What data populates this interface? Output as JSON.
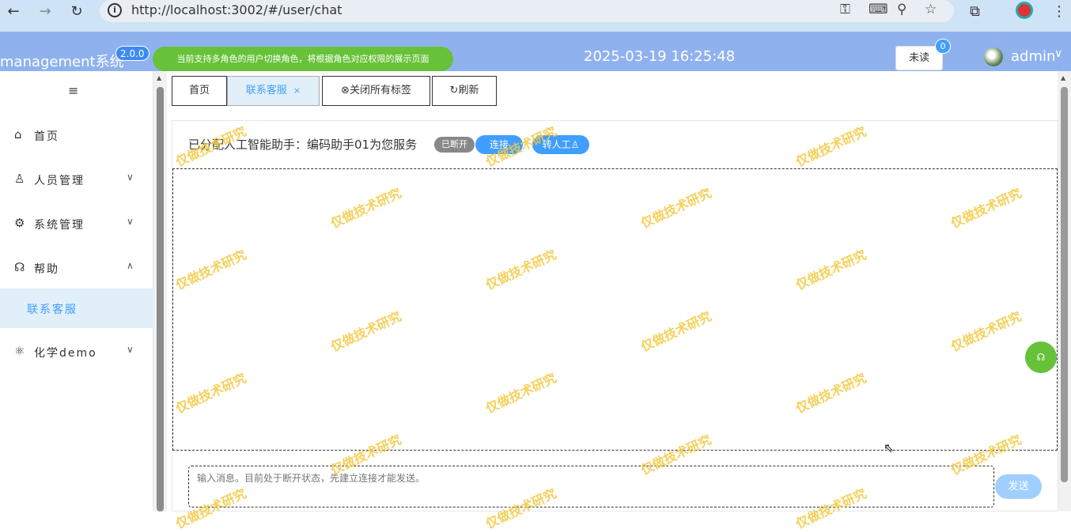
{
  "browser": {
    "url": "http://localhost:3002/#/user/chat",
    "back_icon": "←",
    "forward_icon": "→",
    "reload_icon": "↻",
    "info_icon": "i",
    "key_icon": "⚿",
    "translate_icon": "⌨",
    "zoom_icon": "⚲",
    "star_icon": "☆",
    "ext_icon": "⧉",
    "menu_icon": "⋮"
  },
  "header": {
    "app_title": "management系统",
    "version": "2.0.0",
    "notice": "当前支持多角色的用户切换角色，将根据角色对应权限的展示页面",
    "clock": "2025-03-19 16:25:48",
    "unread_label": "未读",
    "unread_count": "0",
    "username": "admin",
    "chevron": "∨"
  },
  "sidebar": {
    "toggle_icon": "≡",
    "items": [
      {
        "label": "首页",
        "icon": "⌂",
        "chevron": ""
      },
      {
        "label": "人员管理",
        "icon": "♙",
        "chevron": "∨"
      },
      {
        "label": "系统管理",
        "icon": "⚙",
        "chevron": "∨"
      },
      {
        "label": "帮助",
        "icon": "☊",
        "chevron": "∧"
      },
      {
        "label": "化学demo",
        "icon": "⚛",
        "chevron": "∨"
      }
    ],
    "subitem": "联系客服"
  },
  "tabs": [
    {
      "label": "首页"
    },
    {
      "label": "联系客服",
      "close": "×"
    },
    {
      "label": "⊗关闭所有标签"
    },
    {
      "label": "↻刷新"
    }
  ],
  "chat": {
    "assign_text": "已分配人工智能助手：编码助手01为您服务",
    "status": "已断开",
    "connect": "连接",
    "transfer": "转人工♙",
    "input_placeholder": "输入消息。目前处于断开状态，先建立连接才能发送。",
    "send": "发送",
    "help_icon": "☊"
  },
  "watermark_text": "仅做技术研究",
  "colors": {
    "header_bg": "#8fb2ef",
    "accent": "#409eff",
    "notice_green": "#67c23a",
    "watermark": "#f3c940"
  }
}
